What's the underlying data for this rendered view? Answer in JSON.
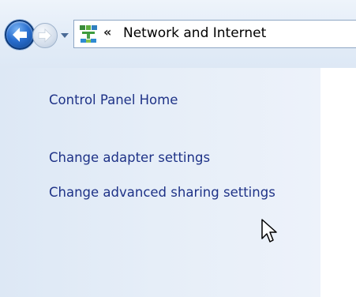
{
  "address_bar": {
    "separator": "«",
    "location": "Network and Internet"
  },
  "left_pane": {
    "links": [
      {
        "label": "Control Panel Home"
      },
      {
        "label": "Change adapter settings"
      },
      {
        "label": "Change advanced sharing settings"
      }
    ]
  },
  "icons": {
    "back": "back-arrow-icon",
    "forward": "forward-arrow-icon",
    "history": "dropdown-arrow-icon",
    "address": "control-panel-icon",
    "cursor": "mouse-pointer-icon"
  }
}
